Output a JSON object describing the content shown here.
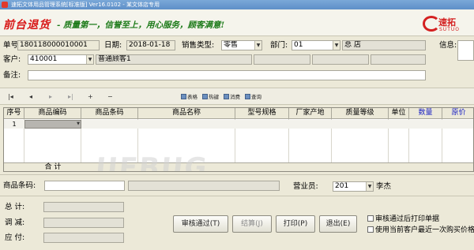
{
  "window": {
    "title": "速拓文体用品管理系统[标准版]  Ver16.0102  -  某文体店专用"
  },
  "banner": {
    "heading": "前台退货",
    "slogan": "- 质量第一，信誉至上，用心服务，顾客满意!",
    "logo_cn": "速拓",
    "logo_en": "SUTUO"
  },
  "form": {
    "order_no_label": "单号:",
    "order_no": "180118000010001",
    "date_label": "日期:",
    "date": "2018-01-18",
    "sale_type_label": "销售类型:",
    "sale_type": "零售",
    "dept_label": "部门:",
    "dept_code": "01",
    "dept_name": "总  店",
    "info_label": "信息:",
    "customer_label": "客户:",
    "customer_code": "410001",
    "customer_name": "普通顾客1",
    "remark_label": "备注:"
  },
  "toolbar": {
    "nav": [
      "|◂",
      "◂",
      "▸",
      "▸|",
      "+",
      "−"
    ],
    "buttons": [
      "表格",
      "热键",
      "消费",
      "查询"
    ]
  },
  "grid": {
    "columns": [
      "序号",
      "商品编码",
      "商品条码",
      "商品名称",
      "型号规格",
      "厂家产地",
      "质量等级",
      "单位",
      "数量",
      "原价"
    ],
    "blue_columns": [
      "数量",
      "原价"
    ],
    "rows": [
      [
        "1",
        "",
        "",
        "",
        "",
        "",
        "",
        "",
        "",
        ""
      ]
    ],
    "total_label": "合  计"
  },
  "watermark": "UEBUG",
  "bottom": {
    "barcode_label": "商品条码:",
    "salesman_label": "营业员:",
    "salesman_code": "201",
    "salesman_name": "李杰",
    "total_label": "总    计:",
    "adjust_label": "调    减:",
    "pay_label": "应    付:",
    "buttons": [
      {
        "label": "审核通过(T)",
        "enabled": true
      },
      {
        "label": "结算(J)",
        "enabled": false
      },
      {
        "label": "打印(P)",
        "enabled": true
      },
      {
        "label": "退出(E)",
        "enabled": true
      }
    ],
    "check_print": "审核通过后打印单据",
    "check_lastprice": "使用当前客户最近一次购买价格"
  },
  "colors": {
    "heading": "#d81818",
    "slogan": "#1c7a18",
    "blue_header": "#1b22c4",
    "background": "#ece9d8"
  }
}
